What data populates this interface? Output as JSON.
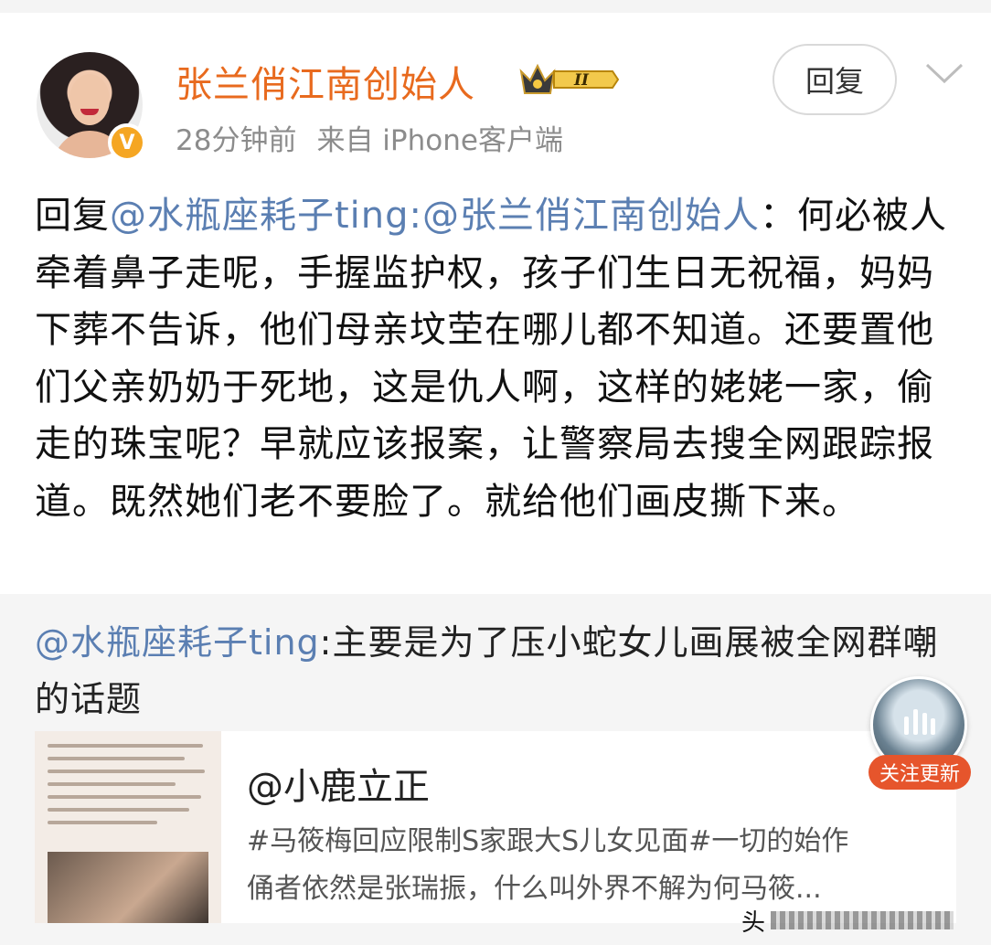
{
  "header": {
    "username": "张兰俏江南创始人",
    "level_badge": "II",
    "verified_badge": "V",
    "time": "28分钟前",
    "source": "来自 iPhone客户端",
    "reply_button": "回复"
  },
  "reply": {
    "prefix": "回复",
    "mention_1": "@水瓶座耗子ting",
    "separator": ":",
    "mention_2": "@张兰俏江南创始人",
    "body": "：何必被人牵着鼻子走呢，手握监护权，孩子们生日无祝福，妈妈下葬不告诉，他们母亲坟茔在哪儿都不知道。还要置他们父亲奶奶于死地，这是仇人啊，这样的姥姥一家，偷走的珠宝呢？早就应该报案，让警察局去搜全网跟踪报道。既然她们老不要脸了。就给他们画皮撕下来。"
  },
  "quoted": {
    "mention": "@水瓶座耗子ting",
    "text": ":主要是为了压小蛇女儿画展被全网群嘲的话题"
  },
  "card": {
    "title": "@小鹿立正",
    "desc_line1": "#马筱梅回应限制S家跟大S儿女见面#一切的始作",
    "desc_line2": "俑者依然是张瑞振，什么叫外界不解为何马筱..."
  },
  "follow_widget": {
    "label": "关注更新"
  },
  "watermark": {
    "text": "头"
  },
  "colors": {
    "username": "#e86a1e",
    "mention": "#5b7fb2",
    "follow_pill": "#e6552c",
    "verified": "#f5a623"
  }
}
